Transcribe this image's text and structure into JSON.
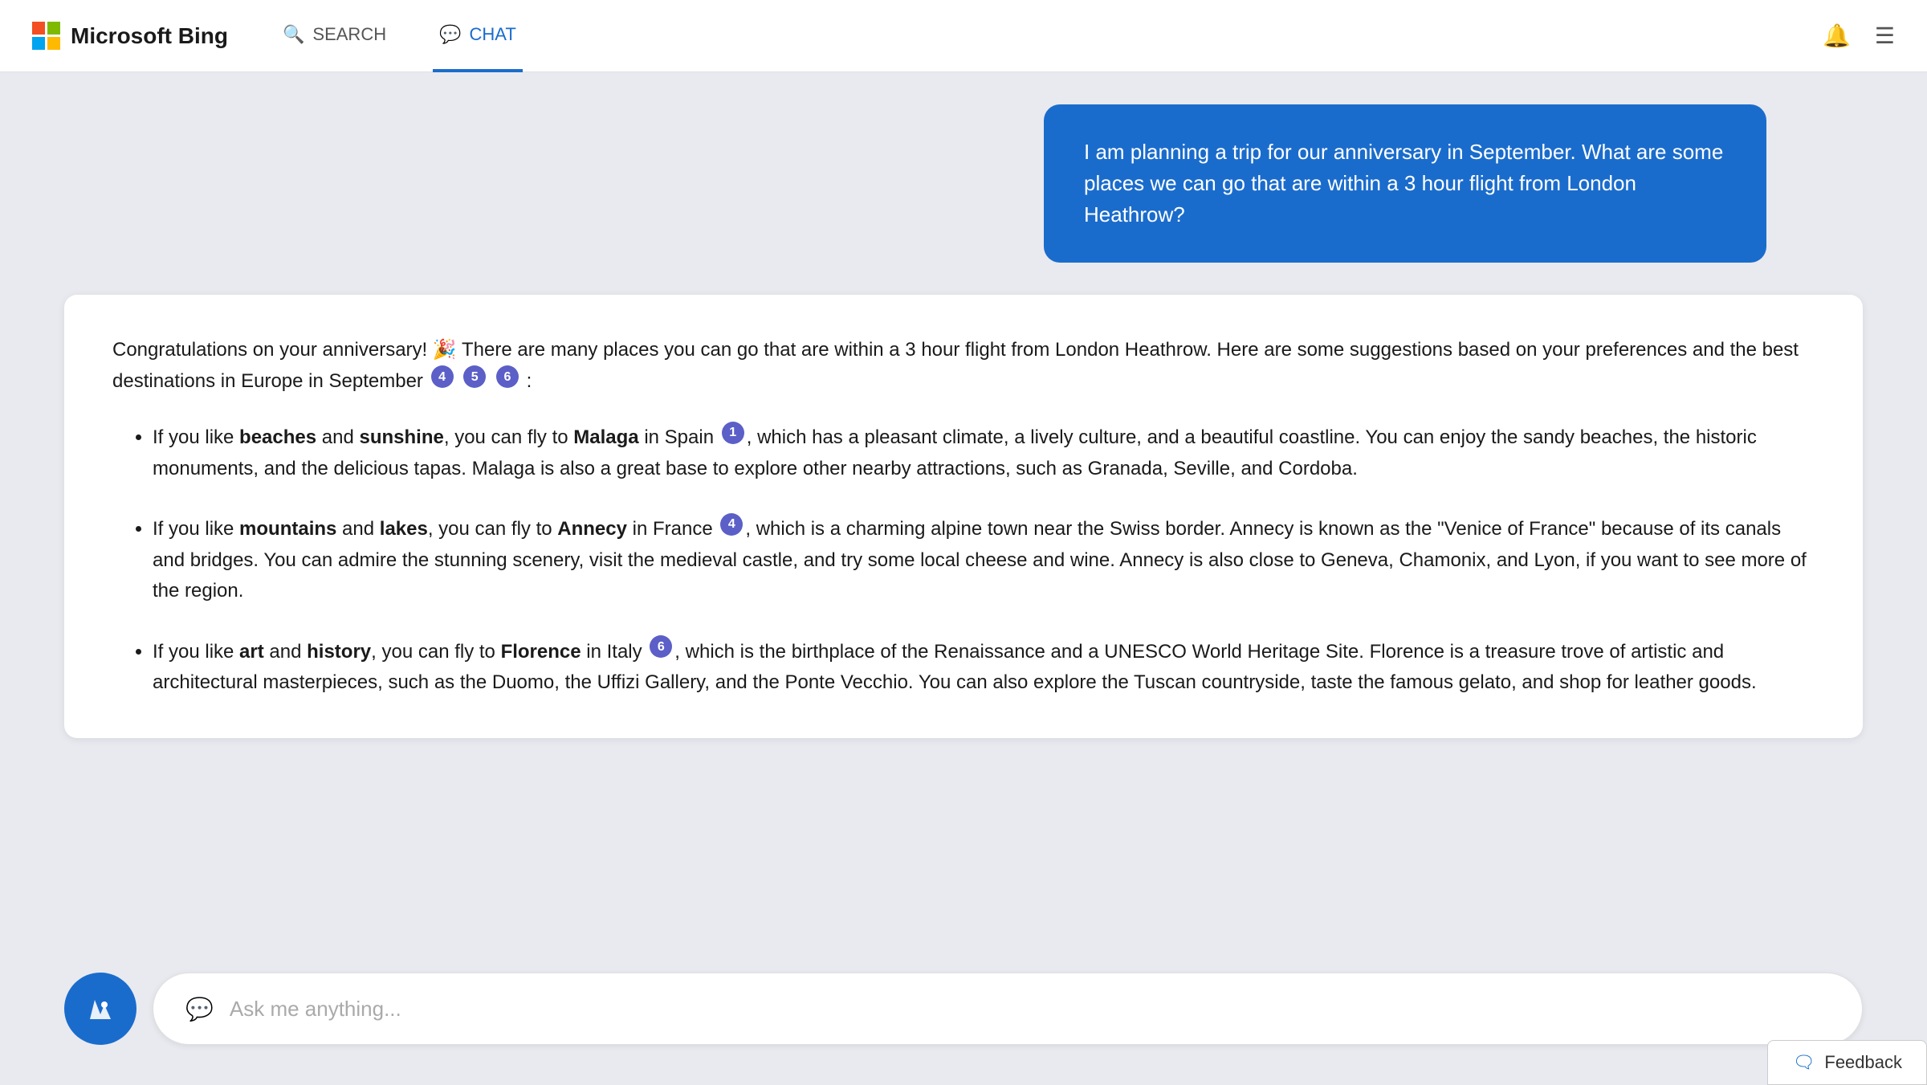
{
  "header": {
    "logo_text": "Microsoft Bing",
    "nav": {
      "search_label": "SEARCH",
      "chat_label": "CHAT"
    }
  },
  "user_message": {
    "text": "I am planning a trip for our anniversary in September. What are some places we can go that are within a 3 hour flight from London Heathrow?"
  },
  "ai_response": {
    "intro": "Congratulations on your anniversary! 🎉 There are many places you can go that are within a 3 hour flight from London Heathrow. Here are some suggestions based on your preferences and the best destinations in Europe in September",
    "intro_citations": [
      "4",
      "5",
      "6"
    ],
    "items": [
      {
        "highlight1": "beaches",
        "connector1": " and ",
        "highlight2": "sunshine",
        "suffix": ", you can fly to ",
        "destination": "Malaga",
        "dest_suffix": " in Spain",
        "citation": "1",
        "description": ", which has a pleasant climate, a lively culture, and a beautiful coastline. You can enjoy the sandy beaches, the historic monuments, and the delicious tapas. Malaga is also a great base to explore other nearby attractions, such as Granada, Seville, and Cordoba."
      },
      {
        "highlight1": "mountains",
        "connector1": " and ",
        "highlight2": "lakes",
        "suffix": ", you can fly to ",
        "destination": "Annecy",
        "dest_suffix": " in France",
        "citation": "4",
        "description": ", which is a charming alpine town near the Swiss border. Annecy is known as the “Venice of France” because of its canals and bridges. You can admire the stunning scenery, visit the medieval castle, and try some local cheese and wine. Annecy is also close to Geneva, Chamonix, and Lyon, if you want to see more of the region."
      },
      {
        "highlight1": "art",
        "connector1": " and ",
        "highlight2": "history",
        "suffix": ", you can fly to ",
        "destination": "Florence",
        "dest_suffix": " in Italy",
        "citation": "6",
        "description": ", which is the birthplace of the Renaissance and a UNESCO World Heritage Site. Florence is a treasure trove of artistic and architectural masterpieces, such as the Duomo, the Uffizi Gallery, and the Ponte Vecchio. You can also explore the Tuscan countryside, taste the famous gelato, and shop for leather goods."
      }
    ]
  },
  "input": {
    "placeholder": "Ask me anything..."
  },
  "feedback": {
    "label": "Feedback"
  }
}
